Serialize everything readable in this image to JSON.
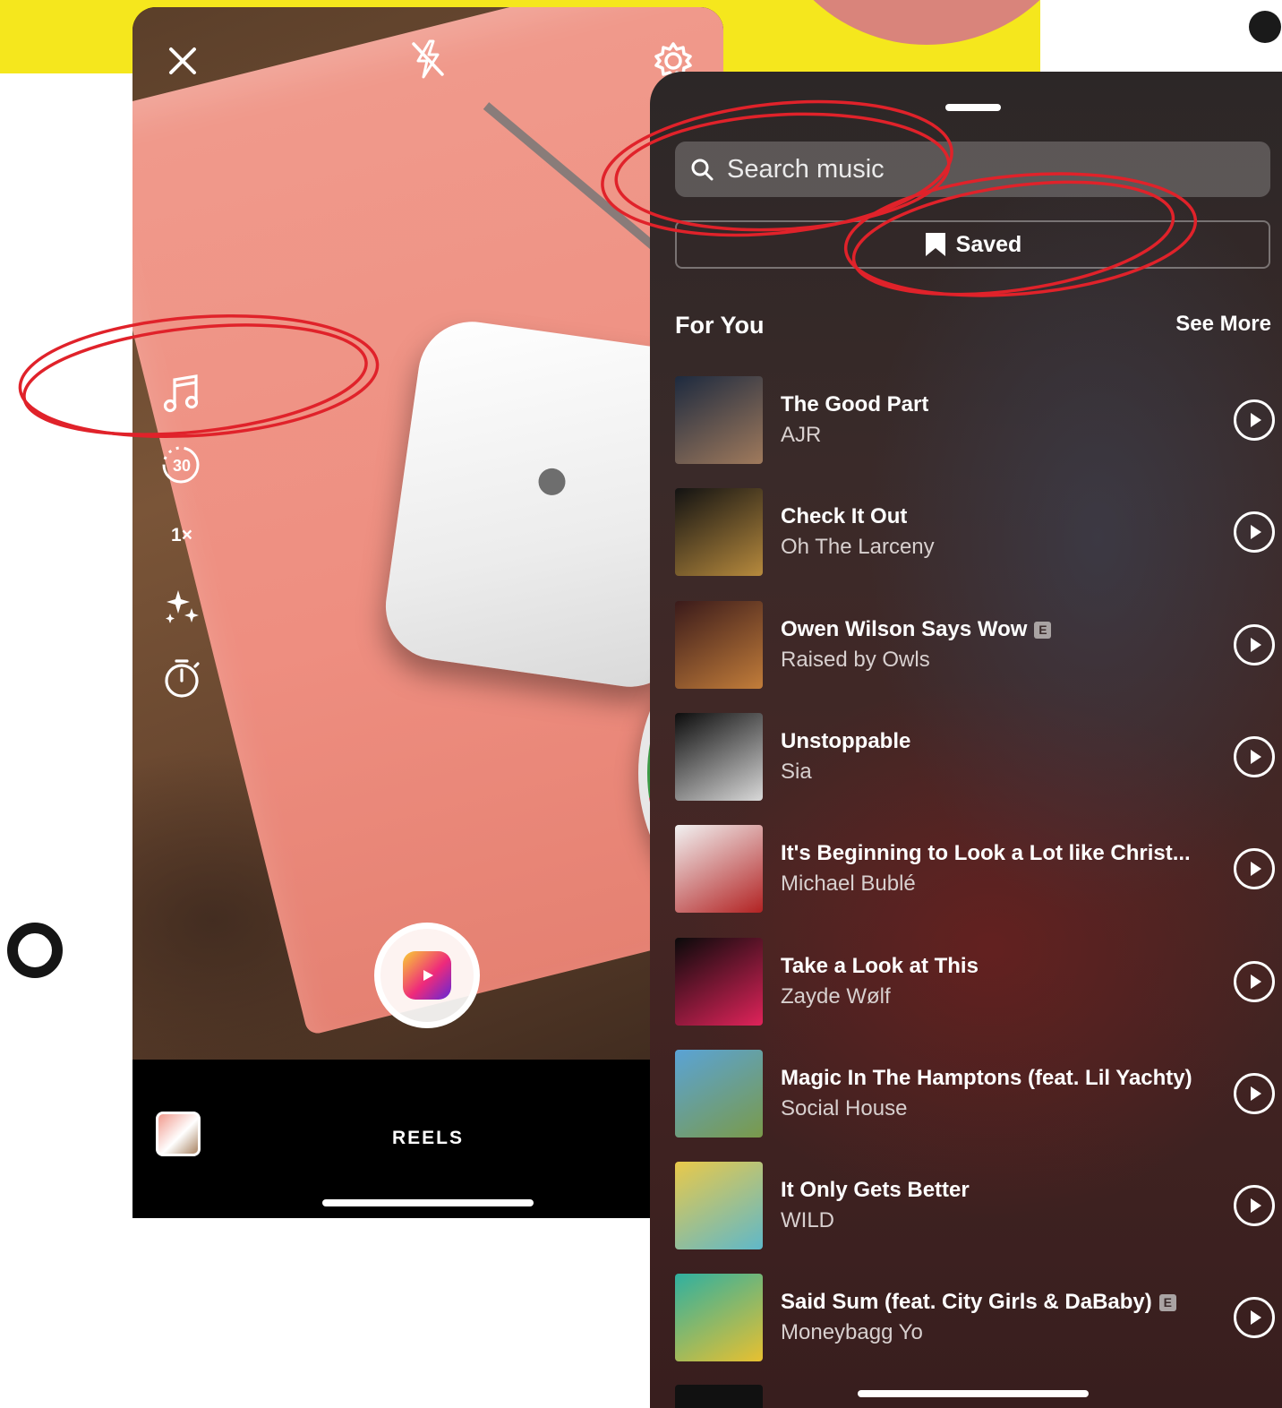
{
  "camera": {
    "mode_label": "REELS",
    "timer_label": "30",
    "speed_label": "1×"
  },
  "music": {
    "search": {
      "placeholder": "Search music"
    },
    "saved_label": "Saved",
    "section_title": "For You",
    "see_more": "See More",
    "tracks": [
      {
        "title": "The Good Part",
        "artist": "AJR",
        "explicit": false,
        "art_colors": [
          "#1d2a3f",
          "#a07a5c"
        ]
      },
      {
        "title": "Check It Out",
        "artist": "Oh The Larceny",
        "explicit": false,
        "art_colors": [
          "#121212",
          "#b78a3d"
        ]
      },
      {
        "title": "Owen Wilson Says Wow",
        "artist": "Raised by Owls",
        "explicit": true,
        "art_colors": [
          "#3a1a1a",
          "#c27d3a"
        ]
      },
      {
        "title": "Unstoppable",
        "artist": "Sia",
        "explicit": false,
        "art_colors": [
          "#0c0c0c",
          "#d9d9d9"
        ]
      },
      {
        "title": "It's Beginning to Look a Lot like Christ...",
        "artist": "Michael Bublé",
        "explicit": false,
        "art_colors": [
          "#f2f2f2",
          "#b22222"
        ]
      },
      {
        "title": "Take a Look at This",
        "artist": "Zayde Wølf",
        "explicit": false,
        "art_colors": [
          "#0a0a0a",
          "#e0235a"
        ]
      },
      {
        "title": "Magic In The Hamptons (feat. Lil Yachty)",
        "artist": "Social House",
        "explicit": false,
        "art_colors": [
          "#5aa3d6",
          "#7a9a4a"
        ]
      },
      {
        "title": "It Only Gets Better",
        "artist": "WILD",
        "explicit": false,
        "art_colors": [
          "#e9c94a",
          "#5fb8c9"
        ]
      },
      {
        "title": "Said Sum (feat. City Girls & DaBaby)",
        "artist": "Moneybagg Yo",
        "explicit": true,
        "art_colors": [
          "#2fb0a0",
          "#e8c030"
        ]
      }
    ],
    "explicit_badge": "E"
  },
  "background": {
    "accent_yellow": "#f5e71d",
    "accent_pink": "#d9847b",
    "annotation_red": "#e0222a"
  },
  "icons": [
    "close-icon",
    "flash-off-icon",
    "settings-icon",
    "music-note-icon",
    "timer-30-icon",
    "speed-icon",
    "effects-sparkle-icon",
    "countdown-timer-icon",
    "reels-icon",
    "search-icon",
    "bookmark-icon",
    "play-icon"
  ]
}
